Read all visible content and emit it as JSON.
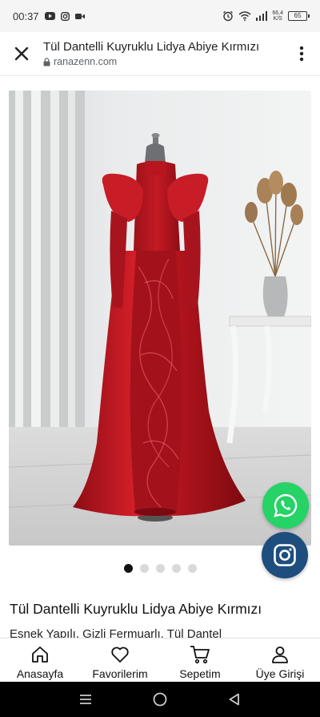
{
  "status_bar": {
    "time": "00:37",
    "left_icons": [
      "youtube-icon",
      "instagram-icon",
      "video-call-icon"
    ],
    "right_icons": [
      "alarm-icon",
      "wifi-icon",
      "signal-icon"
    ],
    "net_speed_value": "66,4",
    "net_speed_unit": "K/S",
    "battery_level": "65"
  },
  "browser": {
    "title": "Tül Dantelli Kuyruklu Lidya Abiye Kırmızı",
    "domain": "ranazenn.com",
    "close_icon": "close-icon",
    "lock_icon": "lock-icon",
    "menu_icon": "more-vert-icon"
  },
  "product": {
    "image_alt": "Red satin evening gown on a dressmaker mannequin",
    "dress_color": "#c0161f",
    "name": "Tül Dantelli Kuyruklu Lidya Abiye Kırmızı",
    "description": "Esnek Yapılı, Gizli Fermuarlı, Tül Dantel",
    "carousel": {
      "total": 5,
      "active_index": 0
    }
  },
  "floating_buttons": {
    "whatsapp": {
      "icon": "whatsapp-icon",
      "color": "#25d366"
    },
    "instagram": {
      "icon": "instagram-icon",
      "color": "#1d4e7e"
    }
  },
  "bottom_nav": {
    "items": [
      {
        "label": "Anasayfa",
        "icon": "home-icon"
      },
      {
        "label": "Favorilerim",
        "icon": "heart-icon"
      },
      {
        "label": "Sepetim",
        "icon": "cart-icon"
      },
      {
        "label": "Üye Girişi",
        "icon": "user-icon"
      }
    ]
  },
  "android_nav": {
    "icons": [
      "recents-icon",
      "home-circle-icon",
      "back-icon"
    ]
  }
}
